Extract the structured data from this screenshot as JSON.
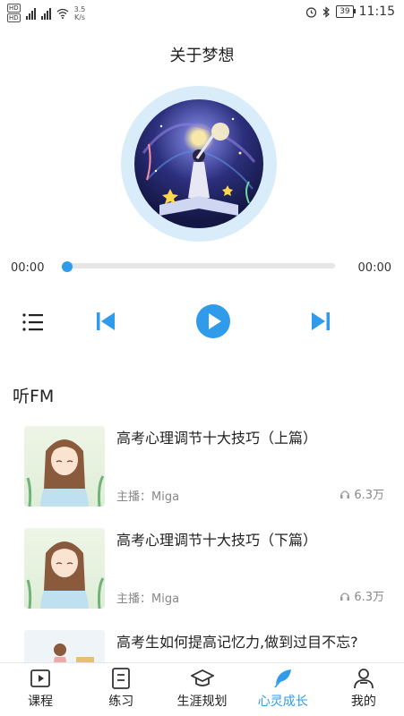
{
  "status_bar": {
    "hd_top": "HD",
    "hd_bottom": "HD",
    "net_speed_value": "3.5",
    "net_speed_unit": "K/s",
    "battery": "39",
    "time": "11:15"
  },
  "player": {
    "title": "关于梦想",
    "current_time": "00:00",
    "total_time": "00:00",
    "progress": 0
  },
  "fm": {
    "section_title": "听FM",
    "items": [
      {
        "title": "高考心理调节十大技巧（上篇）",
        "host": "主播：Miga",
        "plays": "6.3万"
      },
      {
        "title": "高考心理调节十大技巧（下篇）",
        "host": "主播：Miga",
        "plays": "6.3万"
      },
      {
        "title": "高考生如何提高记忆力,做到过目不忘?",
        "host": "",
        "plays": ""
      }
    ]
  },
  "tabs": [
    {
      "label": "课程",
      "icon": "play-square-icon"
    },
    {
      "label": "练习",
      "icon": "list-doc-icon"
    },
    {
      "label": "生涯规划",
      "icon": "graduation-cap-icon"
    },
    {
      "label": "心灵成长",
      "icon": "feather-icon",
      "active": true
    },
    {
      "label": "我的",
      "icon": "user-icon"
    }
  ],
  "colors": {
    "accent": "#2f9bea",
    "ring": "#d9ecf9"
  }
}
